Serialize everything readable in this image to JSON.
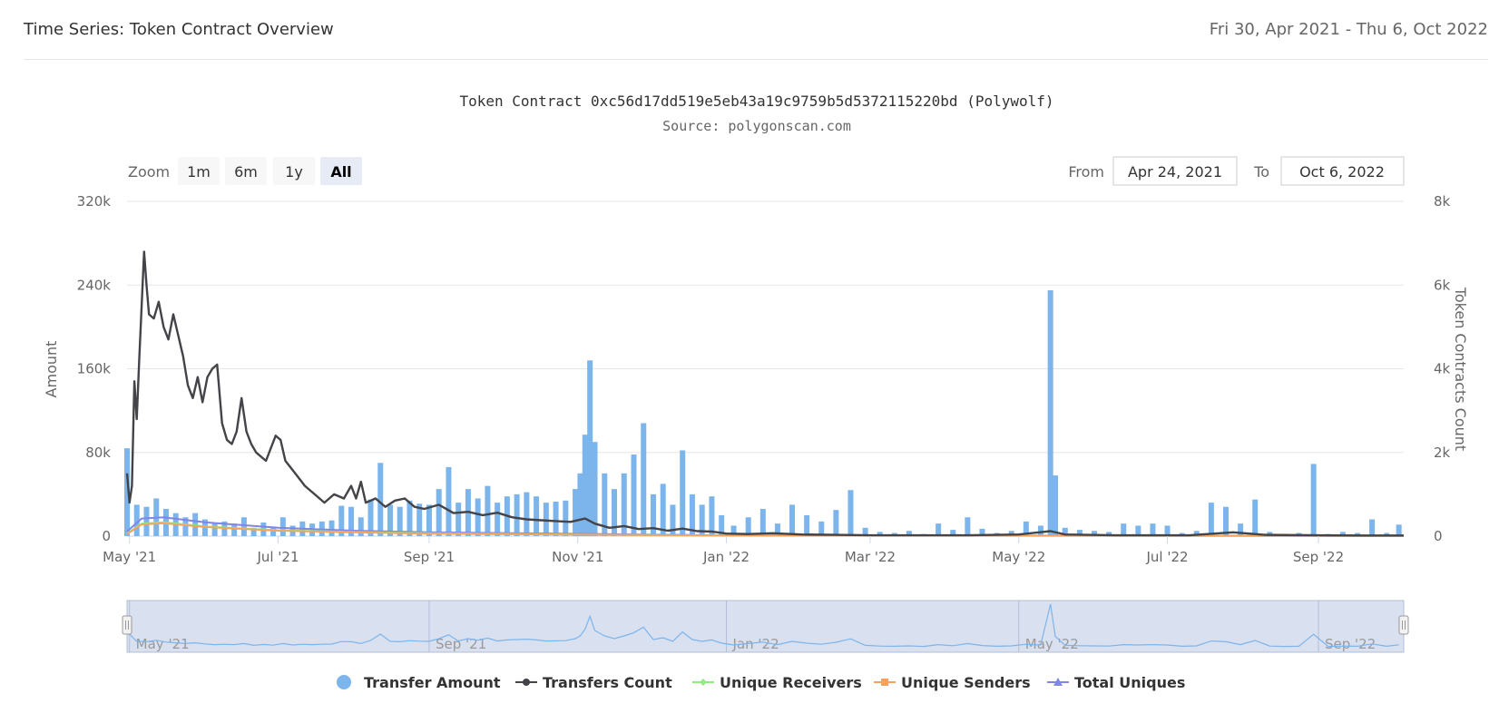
{
  "header": {
    "title": "Time Series: Token Contract Overview",
    "date_range": "Fri 30, Apr 2021 - Thu 6, Oct 2022"
  },
  "controls": {
    "zoom_label": "Zoom",
    "zoom_buttons": [
      "1m",
      "6m",
      "1y",
      "All"
    ],
    "zoom_selected": "All",
    "from_label": "From",
    "from_value": "Apr 24, 2021",
    "to_label": "To",
    "to_value": "Oct 6, 2022"
  },
  "colors": {
    "transfer_amount": "#7cb5ec",
    "transfers_count": "#434348",
    "unique_receivers": "#90ed7d",
    "unique_senders": "#f7a35c",
    "total_uniques": "#8085e9",
    "navigator_fill": "#ccd6eb"
  },
  "chart_data": {
    "type": "bar",
    "title": "Token Contract 0xc56d17dd519e5eb43a19c9759b5d5372115220bd (Polywolf)",
    "subtitle": "Source: polygonscan.com",
    "ylabel": "Amount",
    "y2label": "Token Contracts Count",
    "ylim": [
      0,
      320000
    ],
    "y2lim": [
      0,
      8000
    ],
    "yticks": [
      "0",
      "80k",
      "160k",
      "240k",
      "320k"
    ],
    "y2ticks": [
      "0",
      "2k",
      "4k",
      "6k",
      "8k"
    ],
    "xlim": [
      "2021-04-30",
      "2022-10-06"
    ],
    "xticks": [
      {
        "date": "2021-05-01",
        "label": "May '21"
      },
      {
        "date": "2021-07-01",
        "label": "Jul '21"
      },
      {
        "date": "2021-09-01",
        "label": "Sep '21"
      },
      {
        "date": "2021-11-01",
        "label": "Nov '21"
      },
      {
        "date": "2022-01-01",
        "label": "Jan '22"
      },
      {
        "date": "2022-03-01",
        "label": "Mar '22"
      },
      {
        "date": "2022-05-01",
        "label": "May '22"
      },
      {
        "date": "2022-07-01",
        "label": "Jul '22"
      },
      {
        "date": "2022-09-01",
        "label": "Sep '22"
      }
    ],
    "navigator_ticks": [
      "May '21",
      "Sep '21",
      "Jan '22",
      "May '22",
      "Sep '22"
    ],
    "legend_position": "bottom-center",
    "grid": true,
    "series": [
      {
        "name": "Transfer Amount",
        "type": "column",
        "axis": "left",
        "points": [
          [
            "2021-04-30",
            84000
          ],
          [
            "2021-05-04",
            30000
          ],
          [
            "2021-05-08",
            28000
          ],
          [
            "2021-05-12",
            36000
          ],
          [
            "2021-05-16",
            26000
          ],
          [
            "2021-05-20",
            22000
          ],
          [
            "2021-05-24",
            18000
          ],
          [
            "2021-05-28",
            22000
          ],
          [
            "2021-06-01",
            16000
          ],
          [
            "2021-06-05",
            12000
          ],
          [
            "2021-06-09",
            14000
          ],
          [
            "2021-06-13",
            12000
          ],
          [
            "2021-06-17",
            18000
          ],
          [
            "2021-06-21",
            8000
          ],
          [
            "2021-06-25",
            13000
          ],
          [
            "2021-06-29",
            9000
          ],
          [
            "2021-07-03",
            18000
          ],
          [
            "2021-07-07",
            10000
          ],
          [
            "2021-07-11",
            14000
          ],
          [
            "2021-07-15",
            12000
          ],
          [
            "2021-07-19",
            14000
          ],
          [
            "2021-07-23",
            15000
          ],
          [
            "2021-07-27",
            29000
          ],
          [
            "2021-07-31",
            28000
          ],
          [
            "2021-08-04",
            18000
          ],
          [
            "2021-08-08",
            35000
          ],
          [
            "2021-08-12",
            70000
          ],
          [
            "2021-08-16",
            30000
          ],
          [
            "2021-08-20",
            28000
          ],
          [
            "2021-08-24",
            34000
          ],
          [
            "2021-08-28",
            31000
          ],
          [
            "2021-09-01",
            30000
          ],
          [
            "2021-09-05",
            45000
          ],
          [
            "2021-09-09",
            66000
          ],
          [
            "2021-09-13",
            32000
          ],
          [
            "2021-09-17",
            45000
          ],
          [
            "2021-09-21",
            36000
          ],
          [
            "2021-09-25",
            48000
          ],
          [
            "2021-09-29",
            32000
          ],
          [
            "2021-10-03",
            38000
          ],
          [
            "2021-10-07",
            40000
          ],
          [
            "2021-10-11",
            42000
          ],
          [
            "2021-10-15",
            38000
          ],
          [
            "2021-10-19",
            32000
          ],
          [
            "2021-10-23",
            33000
          ],
          [
            "2021-10-27",
            34000
          ],
          [
            "2021-10-31",
            45000
          ],
          [
            "2021-11-02",
            60000
          ],
          [
            "2021-11-04",
            97000
          ],
          [
            "2021-11-06",
            168000
          ],
          [
            "2021-11-08",
            90000
          ],
          [
            "2021-11-12",
            60000
          ],
          [
            "2021-11-16",
            45000
          ],
          [
            "2021-11-20",
            60000
          ],
          [
            "2021-11-24",
            78000
          ],
          [
            "2021-11-28",
            108000
          ],
          [
            "2021-12-02",
            40000
          ],
          [
            "2021-12-06",
            50000
          ],
          [
            "2021-12-10",
            30000
          ],
          [
            "2021-12-14",
            82000
          ],
          [
            "2021-12-18",
            40000
          ],
          [
            "2021-12-22",
            30000
          ],
          [
            "2021-12-26",
            38000
          ],
          [
            "2021-12-30",
            20000
          ],
          [
            "2022-01-04",
            10000
          ],
          [
            "2022-01-10",
            18000
          ],
          [
            "2022-01-16",
            26000
          ],
          [
            "2022-01-22",
            12000
          ],
          [
            "2022-01-28",
            30000
          ],
          [
            "2022-02-03",
            20000
          ],
          [
            "2022-02-09",
            14000
          ],
          [
            "2022-02-15",
            25000
          ],
          [
            "2022-02-21",
            44000
          ],
          [
            "2022-02-27",
            8000
          ],
          [
            "2022-03-05",
            4000
          ],
          [
            "2022-03-11",
            3000
          ],
          [
            "2022-03-17",
            5000
          ],
          [
            "2022-03-23",
            2000
          ],
          [
            "2022-03-29",
            12000
          ],
          [
            "2022-04-04",
            6000
          ],
          [
            "2022-04-10",
            18000
          ],
          [
            "2022-04-16",
            7000
          ],
          [
            "2022-04-22",
            3000
          ],
          [
            "2022-04-28",
            5000
          ],
          [
            "2022-05-04",
            14000
          ],
          [
            "2022-05-10",
            10000
          ],
          [
            "2022-05-14",
            235000
          ],
          [
            "2022-05-16",
            58000
          ],
          [
            "2022-05-20",
            8000
          ],
          [
            "2022-05-26",
            6000
          ],
          [
            "2022-06-01",
            5000
          ],
          [
            "2022-06-07",
            4000
          ],
          [
            "2022-06-13",
            12000
          ],
          [
            "2022-06-19",
            10000
          ],
          [
            "2022-06-25",
            12000
          ],
          [
            "2022-07-01",
            10000
          ],
          [
            "2022-07-07",
            3000
          ],
          [
            "2022-07-13",
            5000
          ],
          [
            "2022-07-19",
            32000
          ],
          [
            "2022-07-25",
            28000
          ],
          [
            "2022-07-31",
            12000
          ],
          [
            "2022-08-06",
            35000
          ],
          [
            "2022-08-12",
            4000
          ],
          [
            "2022-08-18",
            2000
          ],
          [
            "2022-08-24",
            3000
          ],
          [
            "2022-08-30",
            69000
          ],
          [
            "2022-09-05",
            2000
          ],
          [
            "2022-09-11",
            4000
          ],
          [
            "2022-09-17",
            3000
          ],
          [
            "2022-09-23",
            16000
          ],
          [
            "2022-09-29",
            3000
          ],
          [
            "2022-10-04",
            11000
          ]
        ]
      },
      {
        "name": "Transfers Count",
        "type": "line",
        "axis": "right",
        "points": [
          [
            "2021-04-30",
            1500
          ],
          [
            "2021-05-01",
            800
          ],
          [
            "2021-05-02",
            1200
          ],
          [
            "2021-05-03",
            3700
          ],
          [
            "2021-05-04",
            2800
          ],
          [
            "2021-05-05",
            4200
          ],
          [
            "2021-05-06",
            5500
          ],
          [
            "2021-05-07",
            6800
          ],
          [
            "2021-05-08",
            6000
          ],
          [
            "2021-05-09",
            5300
          ],
          [
            "2021-05-11",
            5200
          ],
          [
            "2021-05-13",
            5600
          ],
          [
            "2021-05-15",
            5000
          ],
          [
            "2021-05-17",
            4700
          ],
          [
            "2021-05-19",
            5300
          ],
          [
            "2021-05-21",
            4800
          ],
          [
            "2021-05-23",
            4300
          ],
          [
            "2021-05-25",
            3600
          ],
          [
            "2021-05-27",
            3300
          ],
          [
            "2021-05-29",
            3800
          ],
          [
            "2021-05-31",
            3200
          ],
          [
            "2021-06-02",
            3800
          ],
          [
            "2021-06-04",
            4000
          ],
          [
            "2021-06-06",
            4100
          ],
          [
            "2021-06-08",
            2700
          ],
          [
            "2021-06-10",
            2300
          ],
          [
            "2021-06-12",
            2200
          ],
          [
            "2021-06-14",
            2500
          ],
          [
            "2021-06-16",
            3300
          ],
          [
            "2021-06-18",
            2500
          ],
          [
            "2021-06-20",
            2200
          ],
          [
            "2021-06-22",
            2000
          ],
          [
            "2021-06-26",
            1800
          ],
          [
            "2021-06-30",
            2400
          ],
          [
            "2021-07-02",
            2300
          ],
          [
            "2021-07-04",
            1800
          ],
          [
            "2021-07-08",
            1500
          ],
          [
            "2021-07-12",
            1200
          ],
          [
            "2021-07-16",
            1000
          ],
          [
            "2021-07-20",
            800
          ],
          [
            "2021-07-24",
            1000
          ],
          [
            "2021-07-28",
            900
          ],
          [
            "2021-07-31",
            1200
          ],
          [
            "2021-08-02",
            900
          ],
          [
            "2021-08-04",
            1300
          ],
          [
            "2021-08-06",
            800
          ],
          [
            "2021-08-10",
            900
          ],
          [
            "2021-08-14",
            700
          ],
          [
            "2021-08-18",
            850
          ],
          [
            "2021-08-22",
            900
          ],
          [
            "2021-08-26",
            700
          ],
          [
            "2021-08-30",
            650
          ],
          [
            "2021-09-05",
            750
          ],
          [
            "2021-09-11",
            550
          ],
          [
            "2021-09-17",
            580
          ],
          [
            "2021-09-23",
            500
          ],
          [
            "2021-09-29",
            560
          ],
          [
            "2021-10-05",
            450
          ],
          [
            "2021-10-11",
            400
          ],
          [
            "2021-10-17",
            380
          ],
          [
            "2021-10-23",
            360
          ],
          [
            "2021-10-29",
            340
          ],
          [
            "2021-11-04",
            420
          ],
          [
            "2021-11-08",
            300
          ],
          [
            "2021-11-14",
            200
          ],
          [
            "2021-11-20",
            240
          ],
          [
            "2021-11-26",
            170
          ],
          [
            "2021-12-02",
            190
          ],
          [
            "2021-12-08",
            130
          ],
          [
            "2021-12-14",
            180
          ],
          [
            "2021-12-20",
            120
          ],
          [
            "2021-12-26",
            110
          ],
          [
            "2022-01-01",
            60
          ],
          [
            "2022-01-10",
            50
          ],
          [
            "2022-01-20",
            70
          ],
          [
            "2022-02-01",
            40
          ],
          [
            "2022-02-15",
            30
          ],
          [
            "2022-03-01",
            20
          ],
          [
            "2022-03-20",
            20
          ],
          [
            "2022-04-10",
            20
          ],
          [
            "2022-05-01",
            40
          ],
          [
            "2022-05-14",
            120
          ],
          [
            "2022-05-20",
            40
          ],
          [
            "2022-06-10",
            20
          ],
          [
            "2022-07-10",
            20
          ],
          [
            "2022-07-28",
            90
          ],
          [
            "2022-08-10",
            30
          ],
          [
            "2022-09-01",
            20
          ],
          [
            "2022-09-20",
            15
          ],
          [
            "2022-10-06",
            15
          ]
        ]
      },
      {
        "name": "Unique Receivers",
        "type": "line",
        "axis": "right",
        "points": [
          [
            "2021-04-30",
            60
          ],
          [
            "2021-05-06",
            300
          ],
          [
            "2021-05-15",
            330
          ],
          [
            "2021-06-01",
            230
          ],
          [
            "2021-07-01",
            140
          ],
          [
            "2021-08-01",
            100
          ],
          [
            "2021-09-01",
            70
          ],
          [
            "2021-11-01",
            40
          ],
          [
            "2022-01-01",
            15
          ],
          [
            "2022-10-06",
            5
          ]
        ]
      },
      {
        "name": "Unique Senders",
        "type": "line",
        "axis": "right",
        "points": [
          [
            "2021-04-30",
            50
          ],
          [
            "2021-05-06",
            280
          ],
          [
            "2021-05-15",
            310
          ],
          [
            "2021-06-01",
            220
          ],
          [
            "2021-07-01",
            130
          ],
          [
            "2021-08-01",
            90
          ],
          [
            "2021-09-01",
            60
          ],
          [
            "2021-11-01",
            35
          ],
          [
            "2022-01-01",
            12
          ],
          [
            "2022-10-06",
            4
          ]
        ]
      },
      {
        "name": "Total Uniques",
        "type": "line",
        "axis": "right",
        "points": [
          [
            "2021-04-30",
            110
          ],
          [
            "2021-05-06",
            420
          ],
          [
            "2021-05-15",
            450
          ],
          [
            "2021-06-01",
            330
          ],
          [
            "2021-07-01",
            200
          ],
          [
            "2021-08-01",
            130
          ],
          [
            "2021-09-01",
            90
          ],
          [
            "2021-11-01",
            55
          ],
          [
            "2022-01-01",
            20
          ],
          [
            "2022-10-06",
            8
          ]
        ]
      }
    ]
  }
}
